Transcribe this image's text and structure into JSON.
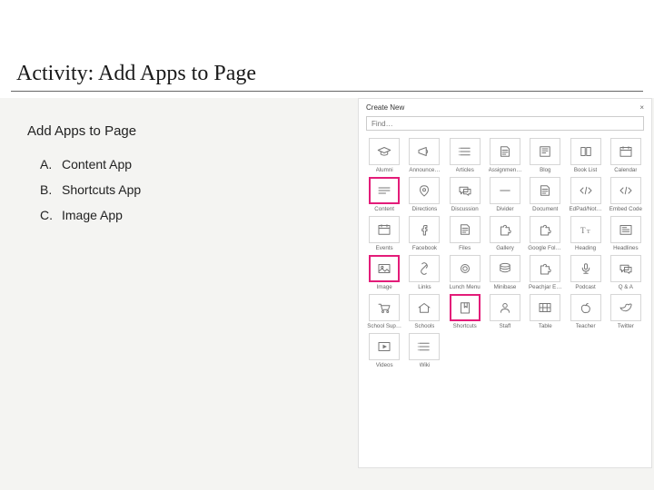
{
  "title": "Activity: Add Apps to Page",
  "subtitle": "Add Apps to Page",
  "list": [
    {
      "letter": "A.",
      "text": "Content App"
    },
    {
      "letter": "B.",
      "text": "Shortcuts App"
    },
    {
      "letter": "C.",
      "text": "Image App"
    }
  ],
  "panel": {
    "header": "Create New",
    "close": "×",
    "search_placeholder": "Find…"
  },
  "tiles": [
    {
      "name": "alumni",
      "label": "Alumni",
      "icon": "grad",
      "hi": false
    },
    {
      "name": "announce",
      "label": "Announce…",
      "icon": "megaphone",
      "hi": false
    },
    {
      "name": "articles",
      "label": "Articles",
      "icon": "list",
      "hi": false
    },
    {
      "name": "assignmen",
      "label": "Assignmen…",
      "icon": "doc",
      "hi": false
    },
    {
      "name": "blog",
      "label": "Blog",
      "icon": "paper",
      "hi": false
    },
    {
      "name": "booklist",
      "label": "Book List",
      "icon": "book",
      "hi": false
    },
    {
      "name": "calendar",
      "label": "Calendar",
      "icon": "calendar",
      "hi": false
    },
    {
      "name": "content",
      "label": "Content",
      "icon": "lines",
      "hi": true
    },
    {
      "name": "directions",
      "label": "Directions",
      "icon": "pin",
      "hi": false
    },
    {
      "name": "discussion",
      "label": "Discussion",
      "icon": "chat",
      "hi": false
    },
    {
      "name": "divider",
      "label": "Divider",
      "icon": "dash",
      "hi": false
    },
    {
      "name": "document",
      "label": "Document",
      "icon": "doc",
      "hi": false
    },
    {
      "name": "edpad",
      "label": "EdPad/Not…",
      "icon": "code",
      "hi": false
    },
    {
      "name": "embedcode",
      "label": "Embed Code",
      "icon": "code",
      "hi": false
    },
    {
      "name": "events",
      "label": "Events",
      "icon": "calendar",
      "hi": false
    },
    {
      "name": "facebook",
      "label": "Facebook",
      "icon": "fb",
      "hi": false
    },
    {
      "name": "files",
      "label": "Files",
      "icon": "doc",
      "hi": false
    },
    {
      "name": "gallery",
      "label": "Gallery",
      "icon": "puzzle",
      "hi": false
    },
    {
      "name": "googlefold",
      "label": "Google Folder",
      "icon": "puzzle",
      "hi": false
    },
    {
      "name": "heading",
      "label": "Heading",
      "icon": "tt",
      "hi": false
    },
    {
      "name": "headlines",
      "label": "Headlines",
      "icon": "news",
      "hi": false
    },
    {
      "name": "image",
      "label": "Image",
      "icon": "image",
      "hi": true
    },
    {
      "name": "links",
      "label": "Links",
      "icon": "link",
      "hi": false
    },
    {
      "name": "lunchmenu",
      "label": "Lunch Menu",
      "icon": "plate",
      "hi": false
    },
    {
      "name": "minibase",
      "label": "Minibase",
      "icon": "stack",
      "hi": false
    },
    {
      "name": "peachjar",
      "label": "Peachjar E…",
      "icon": "puzzle",
      "hi": false
    },
    {
      "name": "podcast",
      "label": "Podcast",
      "icon": "mic",
      "hi": false
    },
    {
      "name": "qa",
      "label": "Q & A",
      "icon": "chat",
      "hi": false
    },
    {
      "name": "schoolsup",
      "label": "School Sup…",
      "icon": "cart",
      "hi": false
    },
    {
      "name": "schools",
      "label": "Schools",
      "icon": "house",
      "hi": false
    },
    {
      "name": "shortcuts",
      "label": "Shortcuts",
      "icon": "bookmark",
      "hi": true
    },
    {
      "name": "staff",
      "label": "Staff",
      "icon": "person",
      "hi": false
    },
    {
      "name": "table",
      "label": "Table",
      "icon": "grid",
      "hi": false
    },
    {
      "name": "teacher",
      "label": "Teacher",
      "icon": "apple",
      "hi": false
    },
    {
      "name": "twitter",
      "label": "Twitter",
      "icon": "bird",
      "hi": false
    },
    {
      "name": "videos",
      "label": "Videos",
      "icon": "play",
      "hi": false
    },
    {
      "name": "wiki",
      "label": "Wiki",
      "icon": "list",
      "hi": false
    }
  ]
}
